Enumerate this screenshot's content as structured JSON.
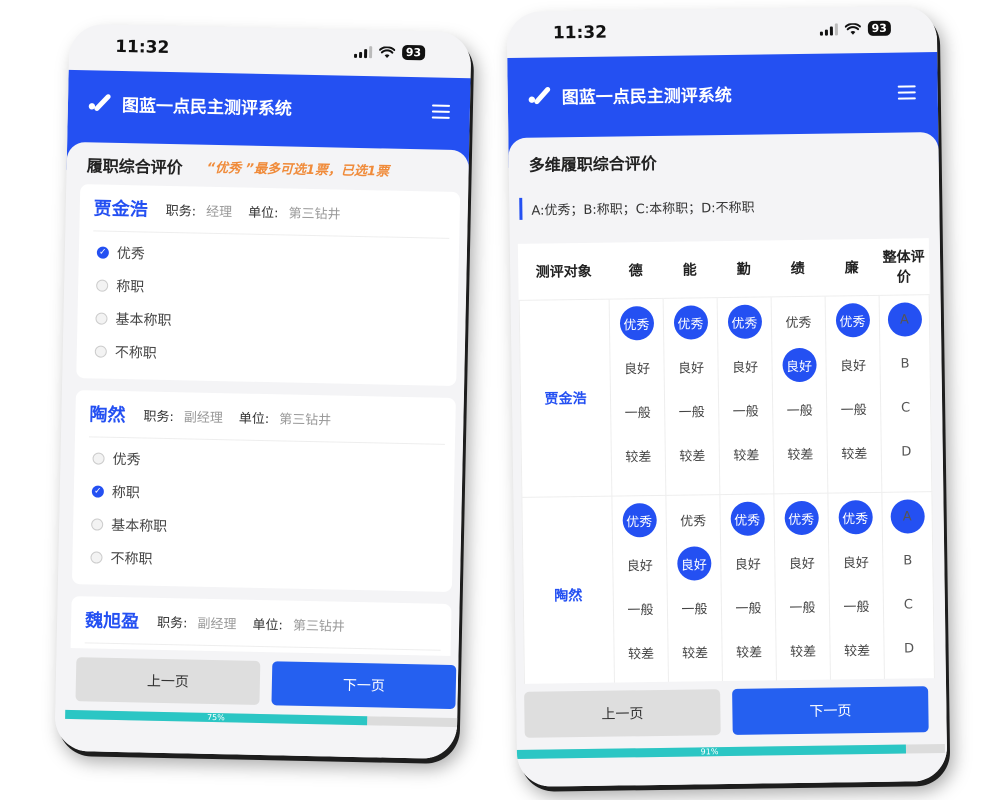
{
  "status": {
    "time": "11:32",
    "battery": "93"
  },
  "app": {
    "title": "图蓝一点民主测评系统"
  },
  "screen1": {
    "section_title": "履职综合评价",
    "notice": "“优秀 ”最多可选1票，已选1票",
    "position_label": "职务:",
    "unit_label": "单位:",
    "people": [
      {
        "name": "贾金浩",
        "position": "经理",
        "unit": "第三钻井",
        "selected": 0
      },
      {
        "name": "陶然",
        "position": "副经理",
        "unit": "第三钻井",
        "selected": 1
      },
      {
        "name": "魏旭盈",
        "position": "副经理",
        "unit": "第三钻井",
        "selected": -1
      }
    ],
    "options": [
      "优秀",
      "称职",
      "基本称职",
      "不称职"
    ],
    "prev_label": "上一页",
    "next_label": "下一页",
    "progress": {
      "value": 0.75,
      "label": "75%"
    }
  },
  "screen2": {
    "section_title": "多维履职综合评价",
    "legend": "A:优秀；B:称职；C:本称职；D:不称职",
    "columns": [
      "测评对象",
      "德",
      "能",
      "勤",
      "绩",
      "廉",
      "整体评价"
    ],
    "grades": [
      "优秀",
      "良好",
      "一般",
      "较差"
    ],
    "overall": [
      "A",
      "B",
      "C",
      "D"
    ],
    "rows": [
      {
        "name": "贾金浩",
        "selected": [
          0,
          0,
          0,
          1,
          0
        ],
        "overall_selected": 0
      },
      {
        "name": "陶然",
        "selected": [
          0,
          1,
          0,
          0,
          0
        ],
        "overall_selected": 0
      }
    ],
    "prev_label": "上一页",
    "next_label": "下一页",
    "progress": {
      "value": 0.91,
      "label": "91%"
    }
  },
  "colors": {
    "brand": "#2450f2",
    "accent_orange": "#f08b3a",
    "progress": "#2bc6c4"
  }
}
